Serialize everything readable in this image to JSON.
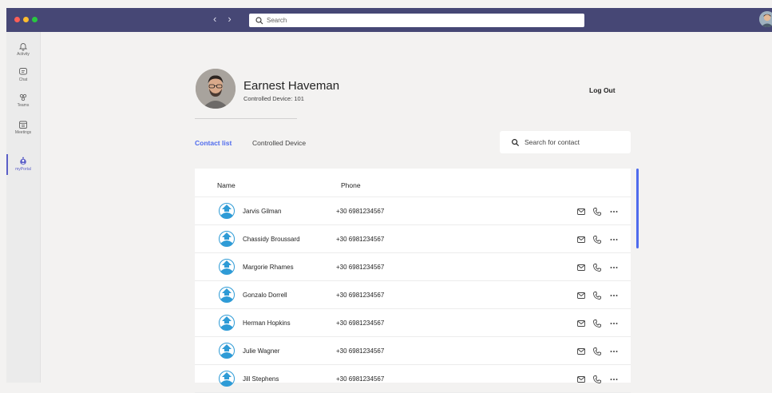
{
  "titlebar": {
    "search_placeholder": "Search",
    "back_arrow": "‹",
    "forward_arrow": "›",
    "traffic_colors": [
      "#ff5f57",
      "#febc2e",
      "#28c840"
    ]
  },
  "rail": {
    "items": [
      {
        "label": "Activity",
        "icon": "bell-icon"
      },
      {
        "label": "Chat",
        "icon": "chat-icon"
      },
      {
        "label": "Teams",
        "icon": "teams-icon"
      },
      {
        "label": "Meetings",
        "icon": "calendar-icon"
      },
      {
        "label": "myPortal",
        "icon": "myportal-icon",
        "active": true
      }
    ]
  },
  "profile": {
    "name": "Earnest Haveman",
    "subtitle": "Controlled Device: 101",
    "logout_label": "Log Out"
  },
  "tabs": [
    {
      "label": "Contact list",
      "active": true
    },
    {
      "label": "Controlled Device",
      "active": false
    }
  ],
  "contact_search": {
    "placeholder": "Search for contact"
  },
  "table": {
    "headers": {
      "name": "Name",
      "phone": "Phone"
    },
    "rows": [
      {
        "name": "Jarvis Gilman",
        "phone": "+30 6981234567"
      },
      {
        "name": "Chassidy Broussard",
        "phone": "+30 6981234567"
      },
      {
        "name": "Margorie Rhames",
        "phone": "+30 6981234567"
      },
      {
        "name": "Gonzalo Dorrell",
        "phone": "+30 6981234567"
      },
      {
        "name": "Herman Hopkins",
        "phone": "+30 6981234567"
      },
      {
        "name": "Julie Wagner",
        "phone": "+30 6981234567"
      },
      {
        "name": "Jill Stephens",
        "phone": "+30 6981234567"
      }
    ],
    "row_actions": [
      "mail-icon",
      "phone-icon",
      "more-icon"
    ]
  },
  "colors": {
    "titlebar": "#464775",
    "accent": "#5b5fc7",
    "tab_active": "#4f6bed",
    "avatar_blue": "#2e9bd6"
  }
}
